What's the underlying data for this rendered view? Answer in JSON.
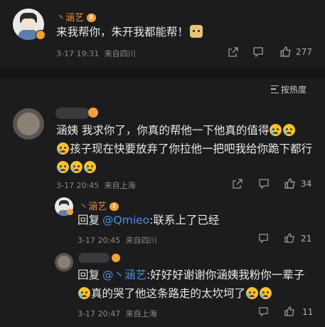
{
  "comment1": {
    "username": "丶涵艺",
    "level_badge": "Ⅱ",
    "text": "来我帮你，朱开我都能帮！",
    "timestamp": "3-17 19:31",
    "location": "来自四川",
    "like_count": "277",
    "emoji": "doge-icon"
  },
  "sort": {
    "label": "按热度"
  },
  "comment2": {
    "text_p1": "涵姨 我求你了，你真的帮他一下他真的值得",
    "text_p2": "孩子现在快要放弃了你拉他一把吧我给你跪下都行",
    "timestamp": "3-17 20:45",
    "location": "来自上海",
    "like_count": "34",
    "reply1": {
      "username": "丶涵艺",
      "prefix": "回复",
      "mention": "@Qmieo",
      "text": ":联系上了已经",
      "timestamp": "3-17 20:45",
      "location": "来自四川",
      "like_count": "21"
    },
    "reply2": {
      "prefix": "回复",
      "mention": "@丶涵艺",
      "text_p1": ":好好好谢谢你涵姨我粉你一辈子",
      "text_p2": "真的哭了他这条路走的太坎坷了",
      "timestamp": "3-17 20:47",
      "location": "来自上海",
      "like_count": "11"
    }
  },
  "colors": {
    "username": "#e88a3a",
    "mention": "#4a90d9",
    "background": "#1c1c1e"
  }
}
